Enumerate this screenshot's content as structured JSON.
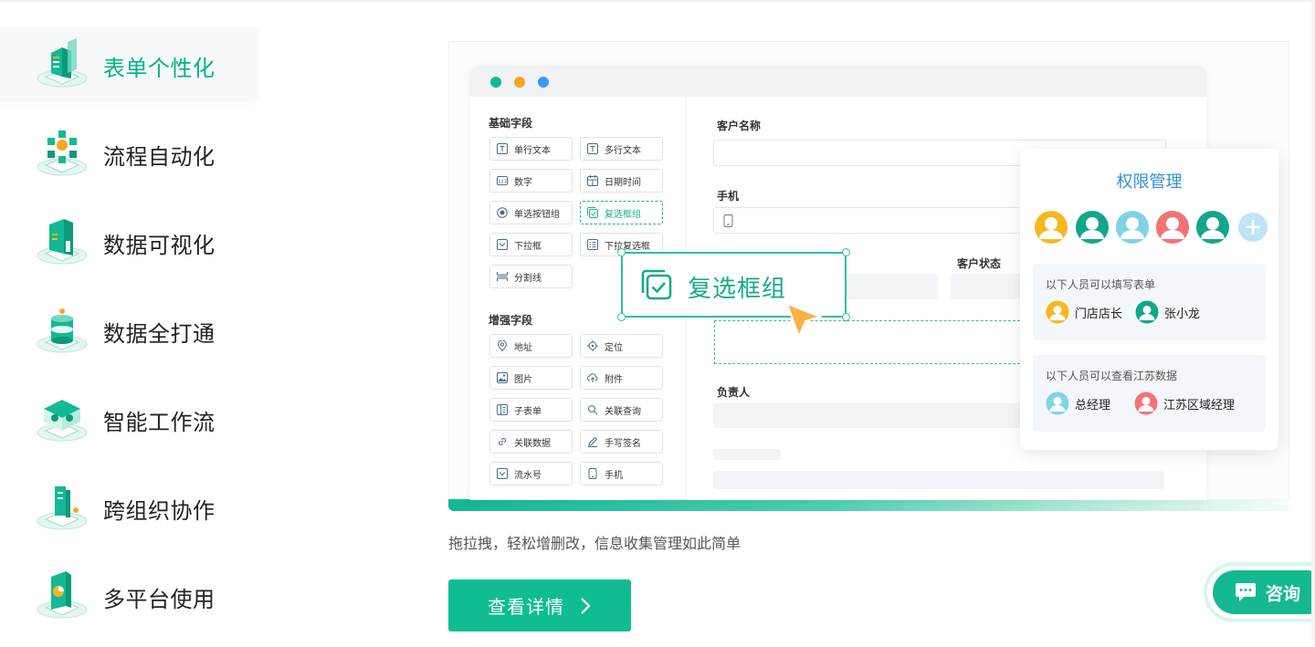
{
  "nav": {
    "items": [
      {
        "label": "表单个性化",
        "icon": "form-building-icon",
        "active": true
      },
      {
        "label": "流程自动化",
        "icon": "flow-network-icon",
        "active": false
      },
      {
        "label": "数据可视化",
        "icon": "data-chart-icon",
        "active": false
      },
      {
        "label": "数据全打通",
        "icon": "database-stack-icon",
        "active": false
      },
      {
        "label": "智能工作流",
        "icon": "workflow-pipe-icon",
        "active": false
      },
      {
        "label": "跨组织协作",
        "icon": "collaboration-icon",
        "active": false
      },
      {
        "label": "多平台使用",
        "icon": "multi-platform-icon",
        "active": false
      }
    ]
  },
  "mockup": {
    "basic_title": "基础字段",
    "basic_fields": [
      "单行文本",
      "多行文本",
      "数字",
      "日期时间",
      "单选按钮组",
      "复选框组",
      "下拉框",
      "下拉复选框",
      "分割线"
    ],
    "enhanced_title": "增强字段",
    "enhanced_fields": [
      "地址",
      "定位",
      "图片",
      "附件",
      "子表单",
      "关联查询",
      "关联数据",
      "手写签名",
      "流水号",
      "手机"
    ],
    "form_labels": {
      "customer_name": "客户名称",
      "phone": "手机",
      "customer_status": "客户状态",
      "owner": "负责人"
    },
    "drag_label": "复选框组",
    "window_dots": [
      "#13b991",
      "#f5a623",
      "#3b9bf0"
    ]
  },
  "permission": {
    "title": "权限管理",
    "fill_label": "以下人员可以填写表单",
    "fill_people": [
      {
        "name": "门店店长",
        "color": "#f6b820"
      },
      {
        "name": "张小龙",
        "color": "#12a68a"
      }
    ],
    "view_label": "以下人员可以查看江苏数据",
    "view_people": [
      {
        "name": "总经理",
        "color": "#7fd3e6"
      },
      {
        "name": "江苏区域经理",
        "color": "#f07476"
      }
    ],
    "avatar_colors": [
      "#f6b820",
      "#12a68a",
      "#7fd3e6",
      "#f07476",
      "#12a68a"
    ]
  },
  "caption": "拖拉拽，轻松增删改，信息收集管理如此简单",
  "cta_label": "查看详情",
  "consult_label": "咨询",
  "colors": {
    "brand": "#10bd92",
    "accent_blue": "#2f8fe0"
  }
}
